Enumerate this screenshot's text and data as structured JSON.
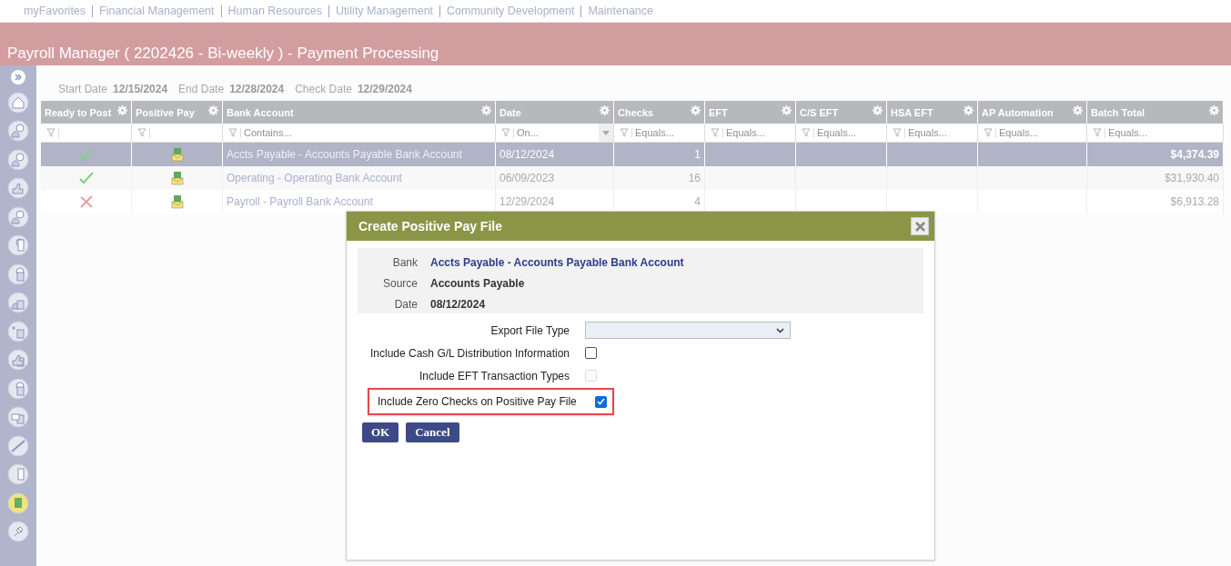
{
  "top_nav": [
    "myFavorites",
    "Financial Management",
    "Human Resources",
    "Utility Management",
    "Community Development",
    "Maintenance"
  ],
  "page_title": "Payroll Manager ( 2202426 - Bi-weekly ) - Payment Processing",
  "dates": [
    {
      "label": "Start Date",
      "value": "12/15/2024"
    },
    {
      "label": "End Date",
      "value": "12/28/2024"
    },
    {
      "label": "Check Date",
      "value": "12/29/2024"
    }
  ],
  "table": {
    "columns": [
      {
        "label": "Ready to Post"
      },
      {
        "label": "Positive Pay"
      },
      {
        "label": "Bank Account",
        "placeholder": "Contains..."
      },
      {
        "label": "Date",
        "placeholder": "On...",
        "dropdown": true
      },
      {
        "label": "Checks",
        "placeholder": "Equals..."
      },
      {
        "label": "EFT",
        "placeholder": "Equals..."
      },
      {
        "label": "C/S EFT",
        "placeholder": "Equals..."
      },
      {
        "label": "HSA EFT",
        "placeholder": "Equals..."
      },
      {
        "label": "AP Automation",
        "placeholder": "Equals..."
      },
      {
        "label": "Batch Total",
        "placeholder": "Equals..."
      }
    ],
    "rows": [
      {
        "selected": true,
        "ready": true,
        "bank_account": "Accts Payable - Accounts Payable Bank Account",
        "date": "08/12/2024",
        "checks": "1",
        "batch_total": "$4,374.39"
      },
      {
        "selected": false,
        "ready": true,
        "bank_account": "Operating - Operating Bank Account",
        "date": "06/09/2023",
        "checks": "16",
        "batch_total": "$31,930.40"
      },
      {
        "selected": false,
        "ready": false,
        "bank_account": "Payroll - Payroll Bank Account",
        "date": "12/29/2024",
        "checks": "4",
        "batch_total": "$6,913.28"
      }
    ]
  },
  "dialog": {
    "title": "Create Positive Pay File",
    "info": [
      {
        "label": "Bank",
        "value": "Accts Payable - Accounts Payable Bank Account",
        "kind": "link"
      },
      {
        "label": "Source",
        "value": "Accounts Payable",
        "kind": "text"
      },
      {
        "label": "Date",
        "value": "08/12/2024",
        "kind": "text"
      }
    ],
    "fields": [
      {
        "kind": "select",
        "label": "Export File Type"
      },
      {
        "kind": "checkbox",
        "label": "Include Cash G/L Distribution Information",
        "checked": false,
        "disabled": false,
        "highlighted": false
      },
      {
        "kind": "checkbox",
        "label": "Include EFT Transaction Types",
        "checked": false,
        "disabled": true,
        "highlighted": false
      },
      {
        "kind": "checkbox",
        "label": "Include Zero Checks on Positive Pay File",
        "checked": true,
        "disabled": false,
        "highlighted": true
      }
    ],
    "buttons": [
      "OK",
      "Cancel"
    ]
  }
}
